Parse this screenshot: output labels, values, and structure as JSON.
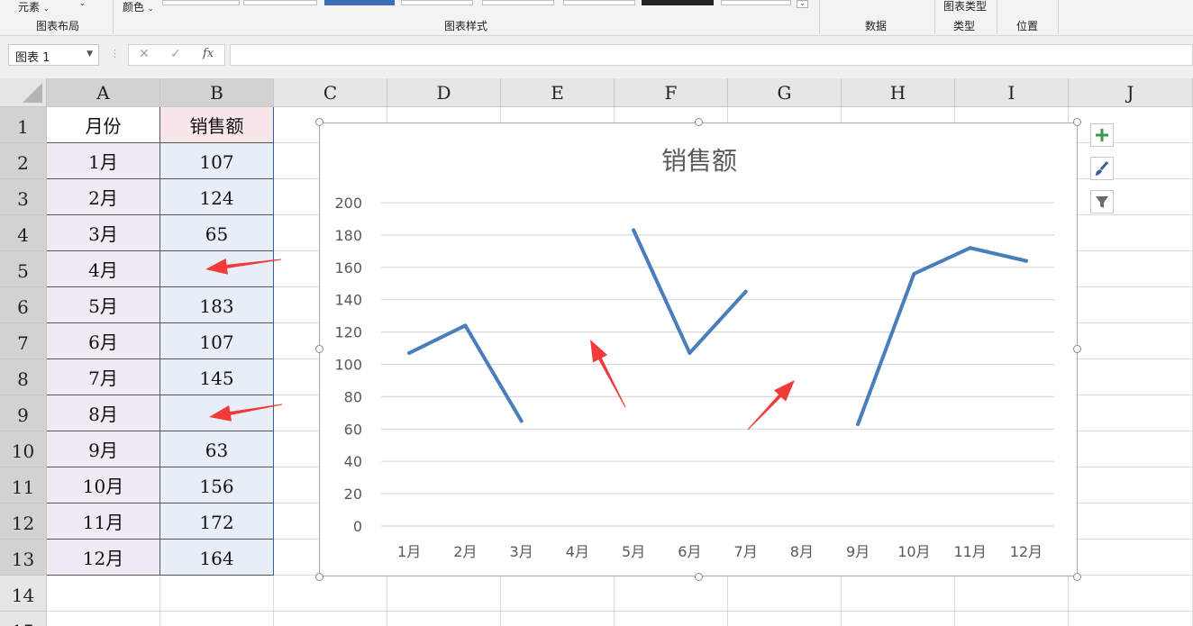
{
  "ribbon": {
    "elements_label": "元素",
    "layout_group": "图表布局",
    "color_label": "颜色",
    "styles_group": "图表样式",
    "data_group": "数据",
    "chart_type_btn": "图表类型",
    "type_group": "类型",
    "position_group": "位置"
  },
  "formula_bar": {
    "name_box": "图表 1",
    "cancel_icon": "✕",
    "enter_icon": "✓",
    "fx_icon": "fx",
    "formula": ""
  },
  "columns": [
    "A",
    "B",
    "C",
    "D",
    "E",
    "F",
    "G",
    "H",
    "I",
    "J"
  ],
  "rows": [
    "1",
    "2",
    "3",
    "4",
    "5",
    "6",
    "7",
    "8",
    "9",
    "10",
    "11",
    "12",
    "13",
    "14",
    "15"
  ],
  "table": {
    "headers": [
      "月份",
      "销售额"
    ],
    "rows": [
      [
        "1月",
        "107"
      ],
      [
        "2月",
        "124"
      ],
      [
        "3月",
        "65"
      ],
      [
        "4月",
        ""
      ],
      [
        "5月",
        "183"
      ],
      [
        "6月",
        "107"
      ],
      [
        "7月",
        "145"
      ],
      [
        "8月",
        ""
      ],
      [
        "9月",
        "63"
      ],
      [
        "10月",
        "156"
      ],
      [
        "11月",
        "172"
      ],
      [
        "12月",
        "164"
      ]
    ]
  },
  "chart_data": {
    "type": "line",
    "title": "销售额",
    "categories": [
      "1月",
      "2月",
      "3月",
      "4月",
      "5月",
      "6月",
      "7月",
      "8月",
      "9月",
      "10月",
      "11月",
      "12月"
    ],
    "series": [
      {
        "values": [
          107,
          124,
          65,
          null,
          183,
          107,
          145,
          null,
          63,
          156,
          172,
          164
        ],
        "color": "#4a7ebb"
      }
    ],
    "ylim": [
      0,
      200
    ],
    "yticks": [
      0,
      20,
      40,
      60,
      80,
      100,
      120,
      140,
      160,
      180,
      200
    ],
    "grid": true,
    "legend": "none"
  },
  "chart_tools": [
    "chart-elements",
    "chart-styles",
    "chart-filters"
  ],
  "colors": {
    "arrow": "#f23a3a",
    "line": "#4a7ebb",
    "gridline": "#d9d9d9",
    "axis_text": "#595959"
  }
}
